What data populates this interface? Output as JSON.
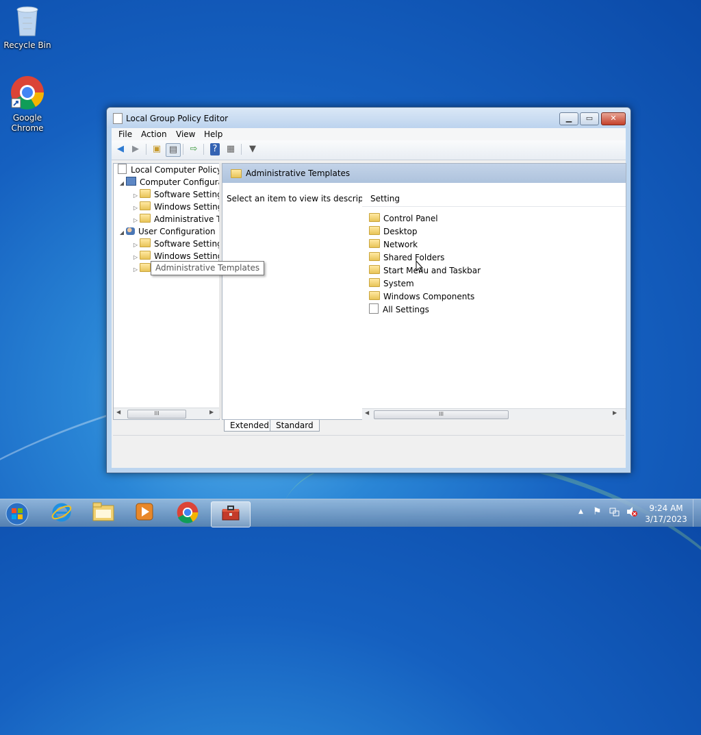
{
  "desktop": {
    "icons": [
      {
        "label": "Recycle Bin"
      },
      {
        "label": "Google\nChrome",
        "line1": "Google",
        "line2": "Chrome"
      }
    ]
  },
  "window": {
    "title": "Local Group Policy Editor",
    "controls": {
      "minimize": "▁",
      "maximize": "▭",
      "close": "✕"
    },
    "menu": [
      "File",
      "Action",
      "View",
      "Help"
    ],
    "tree": {
      "root": "Local Computer Policy",
      "computer": "Computer Configura",
      "computer_children": [
        "Software Settings",
        "Windows Setting",
        "Administrative Te"
      ],
      "user": "User Configuration",
      "user_children": [
        "Software Settings",
        "Windows Setting",
        "Administrative Templates"
      ]
    },
    "right_header": "Administrative Templates",
    "description": "Select an item to view its description.",
    "column_header": "Setting",
    "items": [
      "Control Panel",
      "Desktop",
      "Network",
      "Shared Folders",
      "Start Menu and Taskbar",
      "System",
      "Windows Components",
      "All Settings"
    ],
    "tabs": [
      "Extended",
      "Standard"
    ],
    "tooltip": "Administrative Templates",
    "scroll_grip": "III"
  },
  "taskbar": {
    "clock_time": "9:24 AM",
    "clock_date": "3/17/2023"
  },
  "colors": {
    "accent": "#bcd5ef",
    "header": "#aec3dd"
  }
}
